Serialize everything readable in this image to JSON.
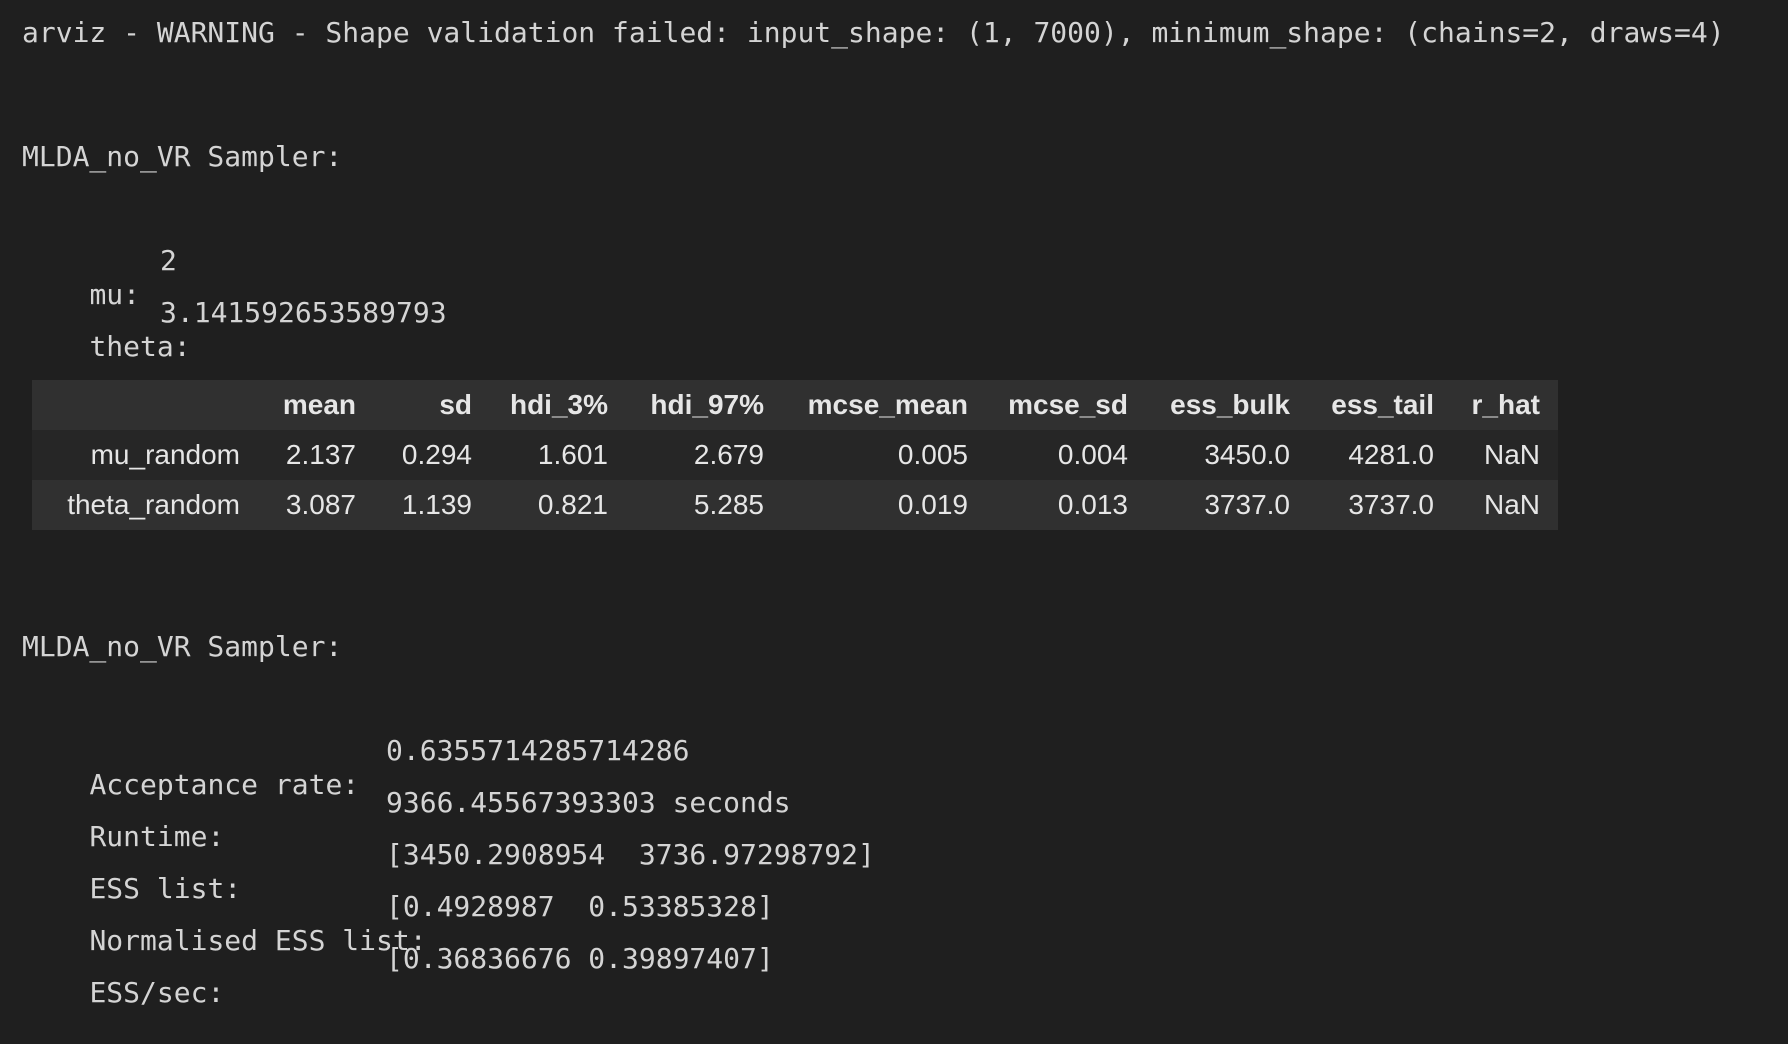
{
  "warning": "arviz - WARNING - Shape validation failed: input_shape: (1, 7000), minimum_shape: (chains=2, draws=4)",
  "sampler_heading_1": "MLDA_no_VR Sampler:",
  "params": [
    {
      "key": "mu:",
      "value": "2"
    },
    {
      "key": "theta:",
      "value": "3.141592653589793"
    }
  ],
  "summary_table": {
    "columns": [
      "",
      "mean",
      "sd",
      "hdi_3%",
      "hdi_97%",
      "mcse_mean",
      "mcse_sd",
      "ess_bulk",
      "ess_tail",
      "r_hat"
    ],
    "rows": [
      [
        "mu_random",
        "2.137",
        "0.294",
        "1.601",
        "2.679",
        "0.005",
        "0.004",
        "3450.0",
        "4281.0",
        "NaN"
      ],
      [
        "theta_random",
        "3.087",
        "1.139",
        "0.821",
        "5.285",
        "0.019",
        "0.013",
        "3737.0",
        "3737.0",
        "NaN"
      ]
    ]
  },
  "sampler_heading_2": "MLDA_no_VR Sampler:",
  "stats": [
    {
      "key": "Acceptance rate:",
      "value": "0.6355714285714286"
    },
    {
      "key": "Runtime:",
      "value": "9366.45567393303 seconds"
    },
    {
      "key": "ESS list:",
      "value": "[3450.2908954  3736.97298792]"
    },
    {
      "key": "Normalised ESS list:",
      "value": "[0.4928987  0.53385328]"
    },
    {
      "key": "ESS/sec:",
      "value": "[0.36836676 0.39897407]"
    }
  ]
}
